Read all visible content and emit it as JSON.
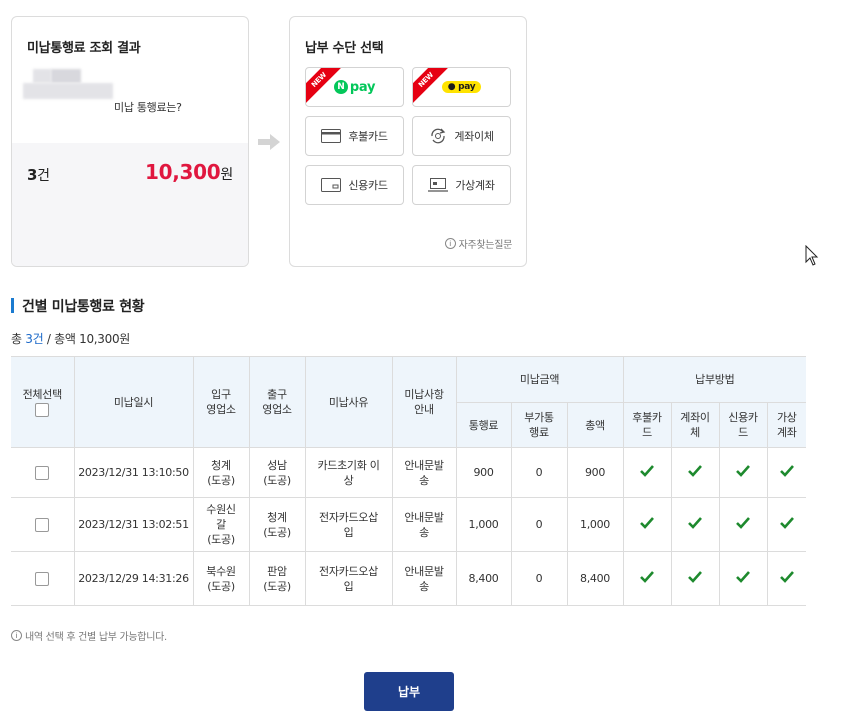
{
  "result_card": {
    "title": "미납통행료 조회 결과",
    "question": "미납 통행료는?",
    "count_number": "3",
    "count_unit": "건",
    "amount_value": "10,300",
    "amount_unit": "원"
  },
  "pay_card": {
    "title": "납부 수단 선택",
    "new_badge": "NEW",
    "npay_label": "pay",
    "npay_n": "N",
    "kakaopay_label": "pay",
    "methods": [
      "후불카드",
      "계좌이체",
      "신용카드",
      "가상계좌"
    ],
    "faq": "자주찾는질문"
  },
  "section": {
    "title": "건별 미납통행료 현황",
    "summary_prefix": "총 ",
    "summary_count": "3건",
    "summary_rest": " / 총액 10,300원"
  },
  "table": {
    "headers": {
      "select_all": "전체선택",
      "date": "미납일시",
      "entry": "입구\n영업소",
      "exit": "출구\n영업소",
      "reason": "미납사유",
      "guide": "미납사항\n안내",
      "amount_group": "미납금액",
      "method_group": "납부방법",
      "toll": "통행료",
      "surcharge": "부가통\n행료",
      "total": "총액",
      "deferred_card": "후불카\n드",
      "transfer": "계좌이\n체",
      "credit_card": "신용카\n드",
      "virtual": "가상\n계좌"
    },
    "rows": [
      {
        "date": "2023/12/31 13:10:50",
        "entry": "청계\n(도공)",
        "exit": "성남\n(도공)",
        "reason": "카드초기화 이\n상",
        "guide": "안내문발\n송",
        "toll": "900",
        "surcharge": "0",
        "total": "900"
      },
      {
        "date": "2023/12/31 13:02:51",
        "entry": "수원신\n갈\n(도공)",
        "exit": "청계\n(도공)",
        "reason": "전자카드오삽\n입",
        "guide": "안내문발\n송",
        "toll": "1,000",
        "surcharge": "0",
        "total": "1,000"
      },
      {
        "date": "2023/12/29 14:31:26",
        "entry": "북수원\n(도공)",
        "exit": "판암\n(도공)",
        "reason": "전자카드오삽\n입",
        "guide": "안내문발\n송",
        "toll": "8,400",
        "surcharge": "0",
        "total": "8,400"
      }
    ]
  },
  "note": "내역 선택 후 건별 납부 가능합니다.",
  "submit_label": "납부",
  "colors": {
    "accent_red": "#e0173f",
    "header_bg": "#eef5fb",
    "submit_bg": "#1f3f8c",
    "check_green": "#1e8a2e",
    "npay_green": "#03c75a",
    "kakao_yellow": "#ffe300"
  }
}
